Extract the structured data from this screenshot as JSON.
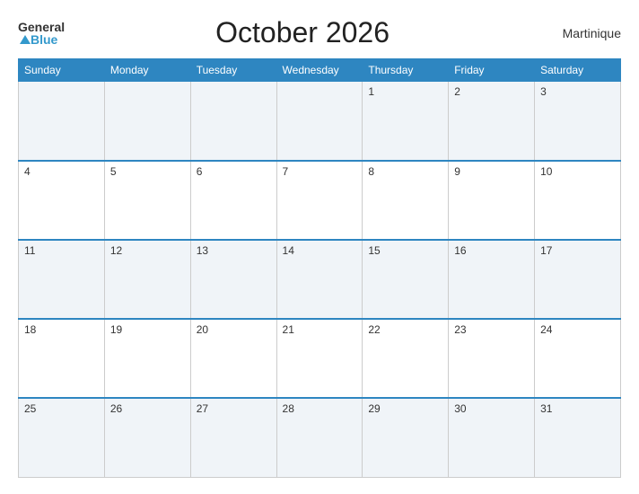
{
  "header": {
    "logo_general": "General",
    "logo_blue": "Blue",
    "title": "October 2026",
    "location": "Martinique"
  },
  "days_of_week": [
    "Sunday",
    "Monday",
    "Tuesday",
    "Wednesday",
    "Thursday",
    "Friday",
    "Saturday"
  ],
  "weeks": [
    [
      null,
      null,
      null,
      null,
      1,
      2,
      3
    ],
    [
      4,
      5,
      6,
      7,
      8,
      9,
      10
    ],
    [
      11,
      12,
      13,
      14,
      15,
      16,
      17
    ],
    [
      18,
      19,
      20,
      21,
      22,
      23,
      24
    ],
    [
      25,
      26,
      27,
      28,
      29,
      30,
      31
    ]
  ]
}
